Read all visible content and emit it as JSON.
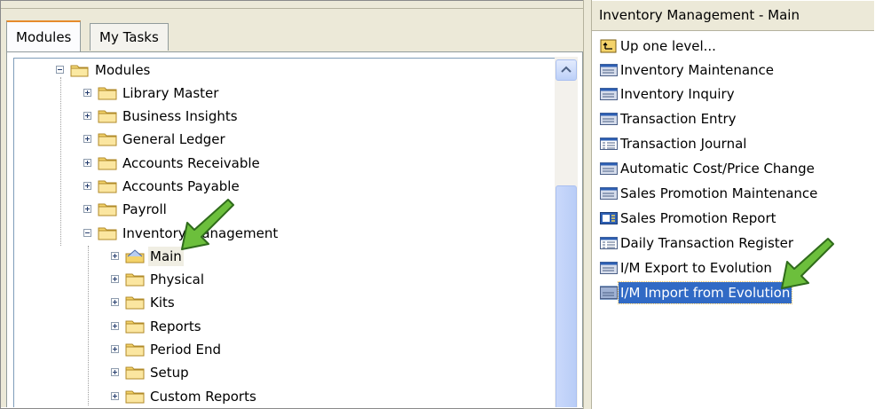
{
  "tabs": [
    "Modules",
    "My Tasks"
  ],
  "tree": {
    "root": "Modules",
    "modules": [
      "Library Master",
      "Business Insights",
      "General Ledger",
      "Accounts Receivable",
      "Accounts Payable",
      "Payroll",
      "Inventory Management"
    ],
    "inventory_children": [
      "Main",
      "Physical",
      "Kits",
      "Reports",
      "Period End",
      "Setup",
      "Custom Reports"
    ]
  },
  "right_panel": {
    "title": "Inventory Management - Main",
    "items": [
      {
        "label": "Up one level...",
        "icon": "up-level-icon"
      },
      {
        "label": "Inventory Maintenance",
        "icon": "form-icon"
      },
      {
        "label": "Inventory Inquiry",
        "icon": "form-icon"
      },
      {
        "label": "Transaction Entry",
        "icon": "form-icon"
      },
      {
        "label": "Transaction Journal",
        "icon": "report-icon"
      },
      {
        "label": "Automatic Cost/Price Change",
        "icon": "form-icon"
      },
      {
        "label": "Sales Promotion Maintenance",
        "icon": "form-icon"
      },
      {
        "label": "Sales Promotion Report",
        "icon": "crystal-report-icon"
      },
      {
        "label": "Daily Transaction Register",
        "icon": "report-icon"
      },
      {
        "label": "I/M Export to Evolution",
        "icon": "form-icon"
      },
      {
        "label": "I/M Import from Evolution",
        "icon": "form-icon"
      }
    ],
    "selected_index": 10
  },
  "colors": {
    "selection": "#316ac5",
    "arrow": "#6cbf3c",
    "tab_accent": "#e68b2c"
  }
}
